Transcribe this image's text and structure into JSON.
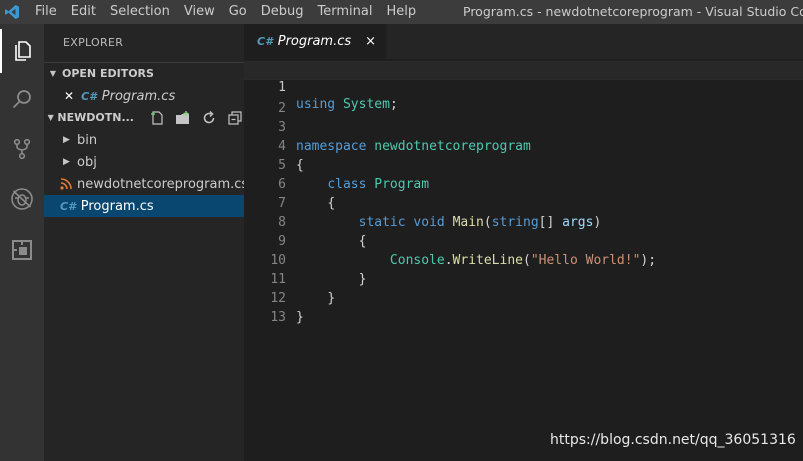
{
  "titlebar": {
    "menu": [
      "File",
      "Edit",
      "Selection",
      "View",
      "Go",
      "Debug",
      "Terminal",
      "Help"
    ],
    "window_title": "Program.cs - newdotnetcoreprogram - Visual Studio Code"
  },
  "activity_bar": {
    "icons": [
      "explorer-icon",
      "search-icon",
      "source-control-icon",
      "debug-icon",
      "extensions-icon"
    ]
  },
  "sidebar": {
    "title": "EXPLORER",
    "open_editors": {
      "label": "OPEN EDITORS",
      "items": [
        {
          "close": "✕",
          "icon": "C#",
          "name": "Program.cs"
        }
      ]
    },
    "project": {
      "label": "NEWDOTN...",
      "items": [
        {
          "name": "bin",
          "type": "folder"
        },
        {
          "name": "obj",
          "type": "folder"
        },
        {
          "name": "newdotnetcoreprogram.cs...",
          "type": "rss"
        },
        {
          "name": "Program.cs",
          "type": "cs",
          "selected": true
        }
      ]
    }
  },
  "editor": {
    "tab": {
      "icon": "C#",
      "label": "Program.cs",
      "close": "×"
    },
    "line_numbers": [
      "1",
      "2",
      "3",
      "4",
      "5",
      "6",
      "7",
      "8",
      "9",
      "10",
      "11",
      "12",
      "13"
    ],
    "current_line": 1,
    "code": {
      "l1_kw": "using",
      "l1_ns": "System",
      "l1_end": ";",
      "l3_kw": "namespace",
      "l3_ns": "newdotnetcoreprogram",
      "l4": "{",
      "l5_kw": "class",
      "l5_ty": "Program",
      "l6": "{",
      "l7_kw1": "static",
      "l7_kw2": "void",
      "l7_fn": "Main",
      "l7_p1": "(",
      "l7_kw3": "string",
      "l7_p2": "[] ",
      "l7_id": "args",
      "l7_p3": ")",
      "l8": "{",
      "l9_ty": "Console",
      "l9_dot": ".",
      "l9_fn": "WriteLine",
      "l9_p1": "(",
      "l9_st": "\"Hello World!\"",
      "l9_p2": ");",
      "l10": "}",
      "l11": "}",
      "l12": "}"
    }
  },
  "watermark": "https://blog.csdn.net/qq_36051316"
}
